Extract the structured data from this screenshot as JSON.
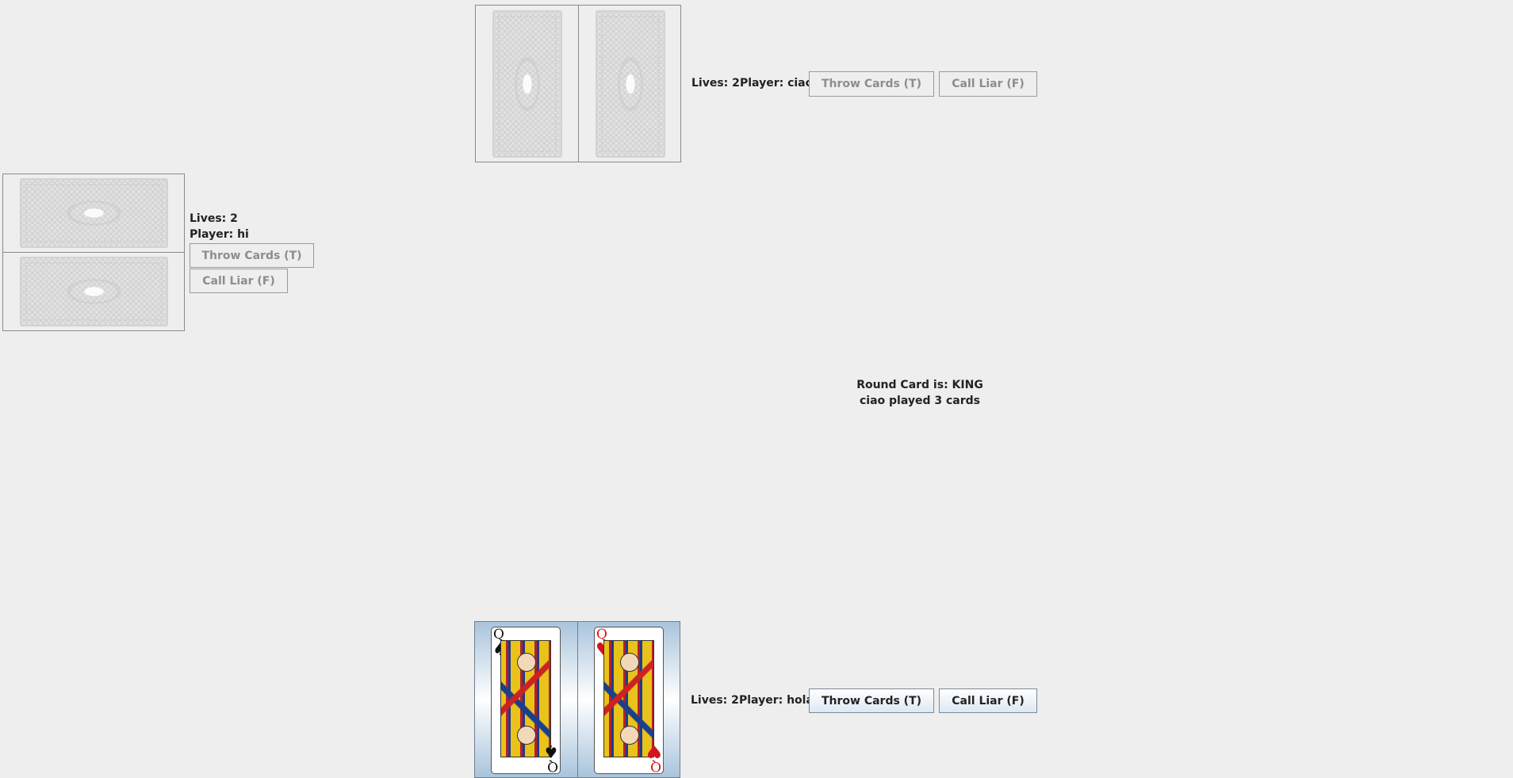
{
  "players": {
    "top": {
      "lives_label": "Lives: 2",
      "player_label": "Player: ciao",
      "throw_label": "Throw Cards (T)",
      "call_label": "Call Liar (F)"
    },
    "left": {
      "lives_label": "Lives: 2",
      "player_label": "Player: hi",
      "throw_label": "Throw Cards (T)",
      "call_label": "Call Liar (F)"
    },
    "bottom": {
      "lives_label": "Lives: 2",
      "player_label": "Player: hola",
      "throw_label": "Throw Cards (T)",
      "call_label": "Call Liar (F)",
      "cards": [
        {
          "rank": "Q",
          "suit": "♠",
          "color": "#111111"
        },
        {
          "rank": "Q",
          "suit": "♥",
          "color": "#d2141e"
        }
      ]
    }
  },
  "center": {
    "round_card": "Round Card is: KING",
    "last_play": "ciao played 3 cards"
  },
  "colors": {
    "background": "#eeeeee",
    "selected_card_bg": "#a9c4dc",
    "disabled_text": "#8d8d8d"
  }
}
